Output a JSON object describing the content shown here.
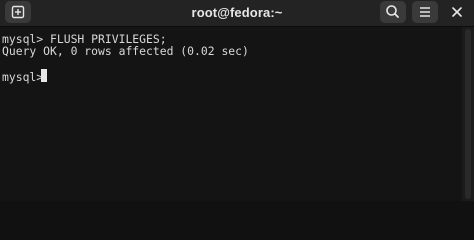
{
  "window": {
    "title": "root@fedora:~"
  },
  "header_buttons": {
    "new_tab_icon": "new-tab-plus-icon",
    "search_icon": "search-icon",
    "menu_icon": "hamburger-menu-icon",
    "close_icon": "close-icon"
  },
  "terminal": {
    "lines": [
      "mysql> FLUSH PRIVILEGES;",
      "Query OK, 0 rows affected (0.02 sec)",
      "mysql> "
    ]
  },
  "colors": {
    "background": "#141414",
    "titlebar": "#232323",
    "text": "#d8d8d8"
  }
}
